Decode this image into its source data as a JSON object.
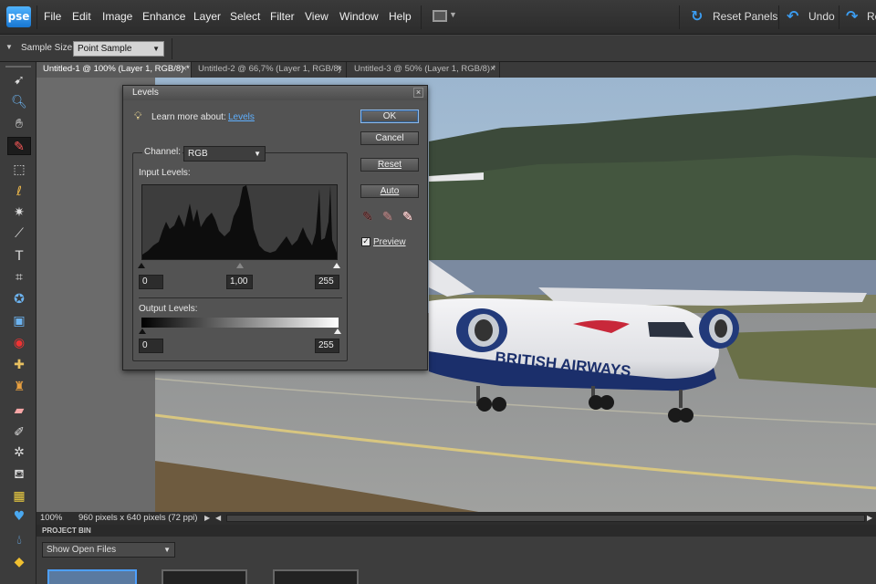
{
  "app": {
    "logo": "pse"
  },
  "menu": [
    "File",
    "Edit",
    "Image",
    "Enhance",
    "Layer",
    "Select",
    "Filter",
    "View",
    "Window",
    "Help"
  ],
  "top_actions": {
    "reset_panels": "Reset Panels",
    "undo": "Undo",
    "redo": "Re"
  },
  "options_bar": {
    "sample_size_label": "Sample Size:",
    "sample_size_value": "Point Sample"
  },
  "tabs": [
    {
      "label": "Untitled-1 @ 100% (Layer 1, RGB/8) *",
      "active": true
    },
    {
      "label": "Untitled-2 @ 66,7% (Layer 1, RGB/8) *",
      "active": false
    },
    {
      "label": "Untitled-3 @ 50% (Layer 1, RGB/8) *",
      "active": false
    }
  ],
  "status": {
    "zoom": "100%",
    "info": "960 pixels x 640 pixels (72 ppi)"
  },
  "project_bin": {
    "title": "PROJECT BIN",
    "show": "Show Open Files"
  },
  "dialog": {
    "title": "Levels",
    "learn_prefix": "Learn more about:",
    "learn_link": "Levels",
    "channel_label": "Channel:",
    "channel_value": "RGB",
    "input_levels_label": "Input Levels:",
    "input_black": "0",
    "input_gamma": "1,00",
    "input_white": "255",
    "output_levels_label": "Output Levels:",
    "output_black": "0",
    "output_white": "255",
    "buttons": {
      "ok": "OK",
      "cancel": "Cancel",
      "reset": "Reset",
      "auto": "Auto"
    },
    "preview_label": "Preview",
    "preview_checked": true
  },
  "photo": {
    "airline": "BRITISH AIRWAYS"
  },
  "icons": {
    "tools": [
      "move-icon",
      "zoom-icon",
      "hand-icon",
      "eyedropper-icon",
      "marquee-icon",
      "lasso-icon",
      "magic-wand-icon",
      "quick-selection-icon",
      "type-icon",
      "crop-icon",
      "cookie-cutter-icon",
      "straighten-icon",
      "red-eye-icon",
      "healing-brush-icon",
      "clone-stamp-icon",
      "eraser-icon",
      "brush-icon",
      "smart-brush-icon",
      "paint-bucket-icon",
      "gradient-icon",
      "shape-icon",
      "blur-icon",
      "sponge-icon"
    ]
  }
}
